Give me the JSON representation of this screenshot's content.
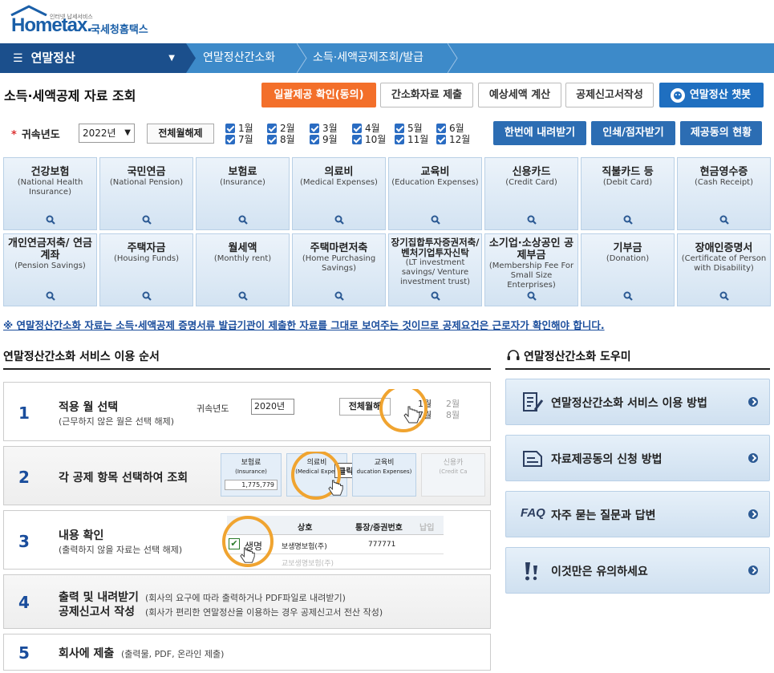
{
  "header": {
    "logo_text": "Hometax.",
    "logo_small": "인터넷 납세서비스",
    "logo_kr": "국세청홈택스"
  },
  "nav": {
    "menu_label": "연말정산",
    "crumbs": [
      "연말정산간소화",
      "소득·세액공제조회/발급"
    ]
  },
  "page": {
    "title": "소득·세액공제 자료 조회",
    "buttons": {
      "bulk_consent": "일괄제공 확인(동의)",
      "submit_simplified": "간소화자료 제출",
      "expected_tax": "예상세액 계산",
      "deduction_report": "공제신고서작성",
      "chatbot": "연말정산 챗봇"
    }
  },
  "filter": {
    "required_mark": "*",
    "year_label": "귀속년도",
    "year_value": "2022년",
    "clear_all": "전체월해제",
    "months": [
      "1월",
      "2월",
      "3월",
      "4월",
      "5월",
      "6월",
      "7월",
      "8월",
      "9월",
      "10월",
      "11월",
      "12월"
    ],
    "download_all": "한번에 내려받기",
    "print_pdf": "인쇄/점자받기",
    "consent_status": "제공동의 현황"
  },
  "tiles_row1": [
    {
      "kr": "건강보험",
      "en": "(National Health Insurance)"
    },
    {
      "kr": "국민연금",
      "en": "(National Pension)"
    },
    {
      "kr": "보험료",
      "en": "(Insurance)"
    },
    {
      "kr": "의료비",
      "en": "(Medical Expenses)"
    },
    {
      "kr": "교육비",
      "en": "(Education Expenses)"
    },
    {
      "kr": "신용카드",
      "en": "(Credit Card)"
    },
    {
      "kr": "직불카드 등",
      "en": "(Debit Card)"
    },
    {
      "kr": "현금영수증",
      "en": "(Cash Receipt)"
    }
  ],
  "tiles_row2": [
    {
      "kr": "개인연금저축/ 연금계좌",
      "en": "(Pension Savings)"
    },
    {
      "kr": "주택자금",
      "en": "(Housing Funds)"
    },
    {
      "kr": "월세액",
      "en": "(Monthly rent)"
    },
    {
      "kr": "주택마련저축",
      "en": "(Home Purchasing Savings)"
    },
    {
      "kr": "장기집합투자증권저축/ 벤처기업투자신탁",
      "en": "(LT investment savings/ Venture investment trust)"
    },
    {
      "kr": "소기업·소상공인 공제부금",
      "en": "(Membership Fee For Small Size Enterprises)"
    },
    {
      "kr": "기부금",
      "en": "(Donation)"
    },
    {
      "kr": "장애인증명서",
      "en": "(Certificate of Person with Disability)"
    }
  ],
  "notice": "※ 연말정산간소화 자료는 소득·세액공제 증명서류 발급기관이 제출한 자료를 그대로 보여주는 것이므로 공제요건은 근로자가 확인해야 합니다.",
  "steps_section": {
    "title": "연말정산간소화 서비스 이용 순서",
    "steps": [
      {
        "num": "1",
        "title": "적용 월 선택",
        "sub": "(근무하지 않은 월은 선택 해제)"
      },
      {
        "num": "2",
        "title": "각 공제 항목 선택하여 조회",
        "sub": ""
      },
      {
        "num": "3",
        "title": "내용 확인",
        "sub": "(출력하지 않을 자료는 선택 해제)"
      },
      {
        "num": "4",
        "title": "출력 및 내려받기",
        "title2": "공제신고서 작성",
        "sub": "(회사의 요구에 따라 출력하거나 PDF파일로 내려받기)",
        "sub2": "(회사가 편리한 연말정산을 이용하는 경우 공제신고서 전산 작성)"
      },
      {
        "num": "5",
        "title": "회사에 제출",
        "sub": "(출력물, PDF, 온라인 제출)"
      }
    ],
    "illus1": {
      "year_label": "귀속년도",
      "year_value": "2020년",
      "clear": "전체월해",
      "m1": "1월",
      "m2": "2월",
      "m7": "7월",
      "m8": "8월"
    },
    "illus2": {
      "ins_kr": "보험료",
      "ins_en": "(Insurance)",
      "ins_amt": "1,775,779",
      "med_kr": "의료비",
      "med_en": "(Medical Expen",
      "click": "클릭!",
      "edu_kr": "교육비",
      "edu_en": "ducation Expenses)",
      "card_kr": "신용카",
      "card_en": "(Credit Ca"
    },
    "illus3": {
      "col1": "상호",
      "col2": "통장/증권번호",
      "col3": "납입",
      "row1_name": "생명",
      "row1_full": "보생명보험(주)",
      "row1_no": "777771",
      "row2_full": "교보생명보험(주)"
    }
  },
  "help_section": {
    "title": "연말정산간소화 도우미",
    "items": [
      {
        "label": "연말정산간소화 서비스 이용 방법",
        "icon": "document-pen-icon"
      },
      {
        "label": "자료제공동의 신청 방법",
        "icon": "document-icon"
      },
      {
        "label": "자주 묻는 질문과 답변",
        "icon": "faq-icon",
        "prefix": "FAQ"
      },
      {
        "label": "이것만은 유의하세요",
        "icon": "exclamation-icon"
      }
    ]
  },
  "colors": {
    "navy": "#1b4f8c",
    "nav_blue": "#3d8ac9",
    "orange": "#f36f2a",
    "accent_blue": "#1f6fc0"
  }
}
